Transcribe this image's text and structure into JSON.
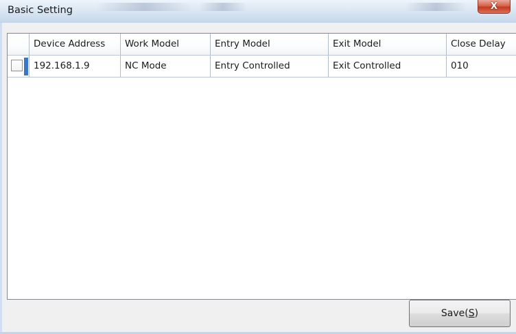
{
  "window": {
    "title": "Basic Setting",
    "close_glyph": "X"
  },
  "table": {
    "columns": [
      "Device Address",
      "Work Model",
      "Entry Model",
      "Exit Model",
      "Close Delay"
    ],
    "rows": [
      {
        "checked": false,
        "device_address": "192.168.1.9",
        "work_model": "NC Mode",
        "entry_model": "Entry Controlled",
        "exit_model": "Exit Controlled",
        "close_delay": "010"
      }
    ]
  },
  "footer": {
    "save_label": "Save(",
    "save_accel": "S",
    "save_label_end": ")"
  },
  "icons": {
    "close": "close-icon",
    "checkbox": "checkbox-icon"
  },
  "colors": {
    "close_button": "#c43b20",
    "row_marker": "#3b77c9"
  }
}
